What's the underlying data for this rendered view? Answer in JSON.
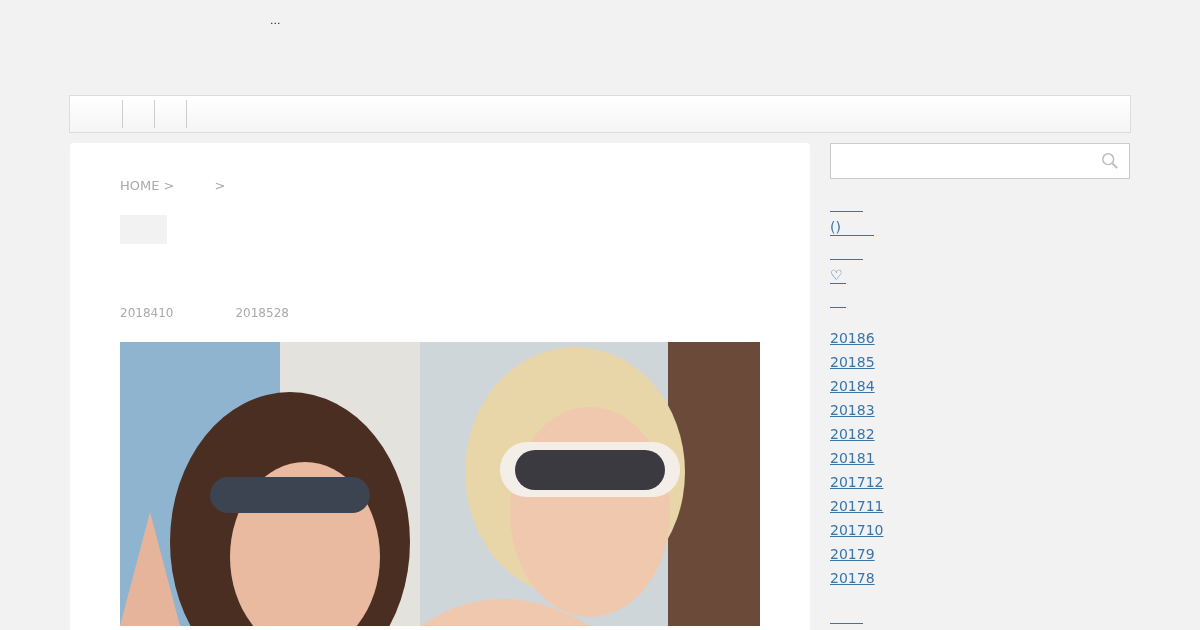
{
  "header": {
    "site_title": "..."
  },
  "breadcrumb": {
    "home": "HOME >",
    "separator": ">"
  },
  "post": {
    "published": "2018410",
    "updated": "2018528"
  },
  "sidebar": {
    "links": [
      {
        "kind": "blank"
      },
      {
        "kind": "text",
        "label": "()"
      },
      {
        "kind": "blank"
      },
      {
        "kind": "text",
        "label": "♡"
      },
      {
        "kind": "blank"
      }
    ],
    "archives": [
      {
        "label": "20186"
      },
      {
        "label": "20185"
      },
      {
        "label": "20184"
      },
      {
        "label": "20183"
      },
      {
        "label": "20182"
      },
      {
        "label": "20181"
      },
      {
        "label": "201712"
      },
      {
        "label": "201711"
      },
      {
        "label": "201710"
      },
      {
        "label": "20179"
      },
      {
        "label": "20178"
      }
    ]
  }
}
